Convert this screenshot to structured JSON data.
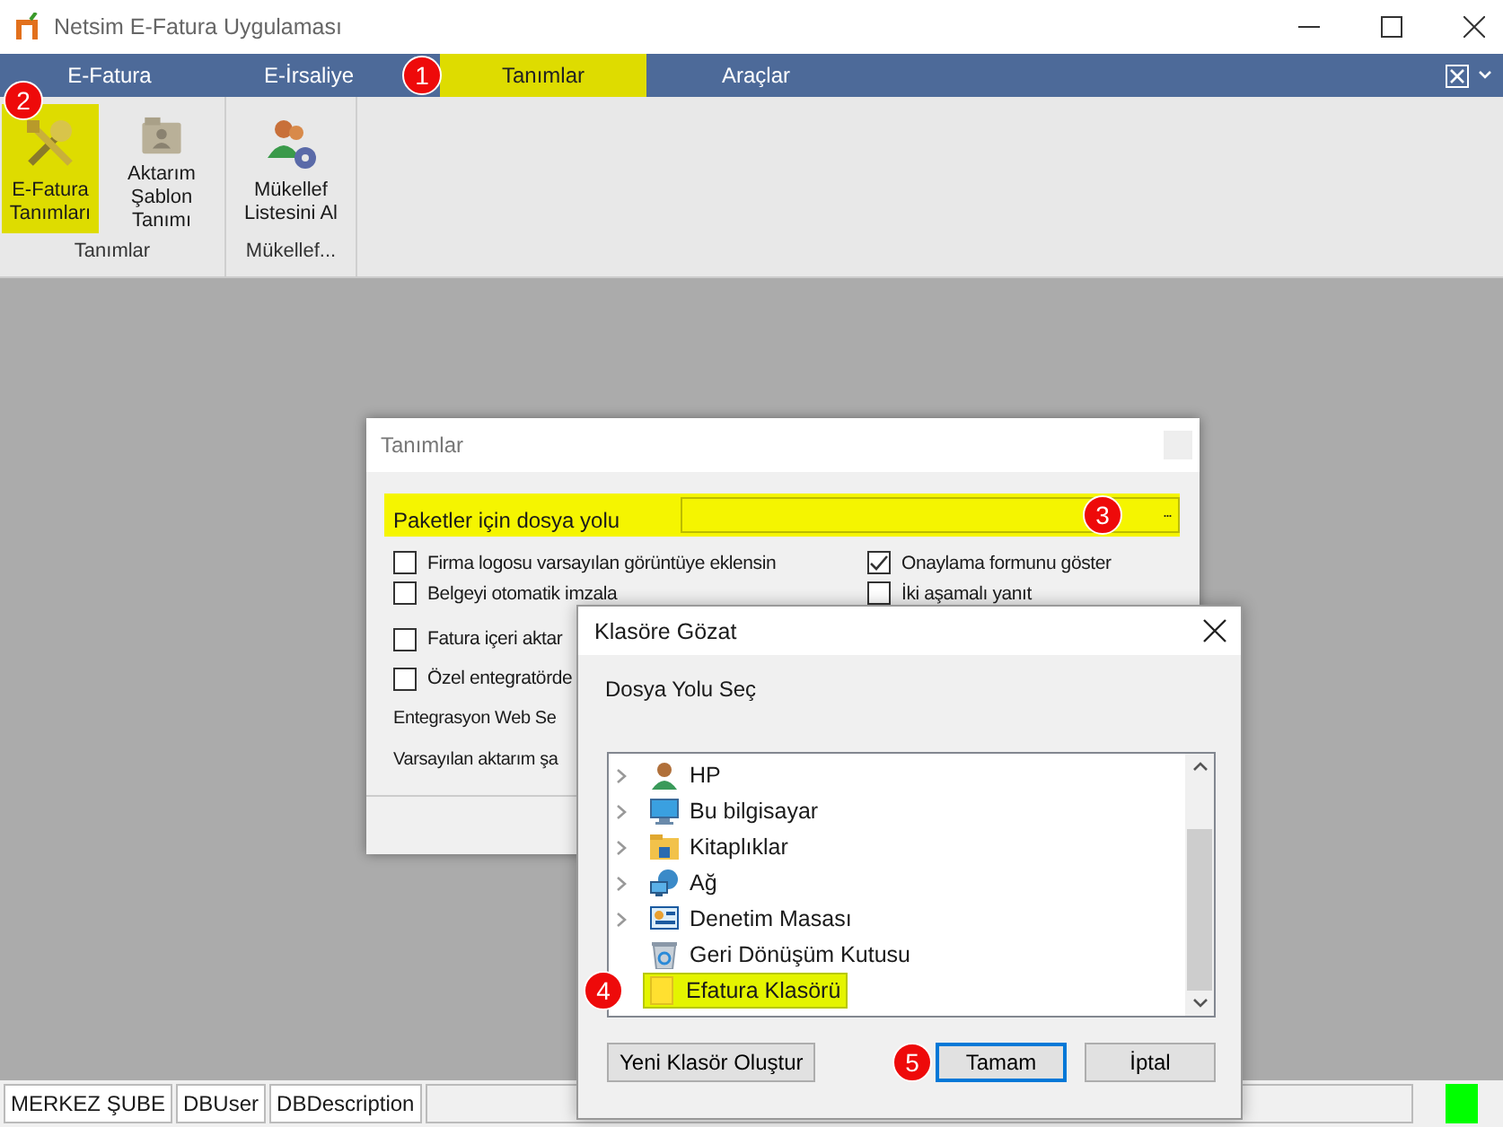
{
  "window": {
    "title": "Netsim E-Fatura Uygulaması"
  },
  "tabs": [
    {
      "label": "E-Fatura",
      "selected": false
    },
    {
      "label": "E-İrsaliye",
      "selected": false
    },
    {
      "label": "Tanımlar",
      "selected": true
    },
    {
      "label": "Araçlar",
      "selected": false
    }
  ],
  "ribbon": {
    "groups": [
      {
        "label": "Tanımlar",
        "buttons": [
          {
            "kind": "tools",
            "label": "E-Fatura Tanımları",
            "selected": true
          },
          {
            "kind": "folder",
            "label": "Aktarım Şablon Tanımı",
            "selected": false
          }
        ]
      },
      {
        "label": "Mükellef...",
        "buttons": [
          {
            "kind": "users",
            "label": "Mükellef Listesini Al",
            "selected": false
          }
        ]
      }
    ]
  },
  "settings_dialog": {
    "title": "Tanımlar",
    "path_label": "Paketler için dosya yolu",
    "browse": "...",
    "options_left": [
      {
        "label": "Firma logosu varsayılan görüntüye eklensin",
        "checked": false
      },
      {
        "label": "Belgeyi otomatik imzala",
        "checked": false
      },
      {
        "label": "Fatura içeri aktar",
        "checked": false
      },
      {
        "label": "Özel entegratörde",
        "checked": false
      }
    ],
    "options_right": [
      {
        "label": "Onaylama formunu göster",
        "checked": true
      },
      {
        "label": "İki aşamalı yanıt",
        "checked": false
      }
    ],
    "fields": [
      "Entegrasyon Web Se",
      "Varsayılan aktarım şa"
    ]
  },
  "browse_dialog": {
    "title": "Klasöre Gözat",
    "prompt": "Dosya Yolu Seç",
    "tree": [
      {
        "kind": "user",
        "label": "HP",
        "expandable": true,
        "selected": false
      },
      {
        "kind": "computer",
        "label": "Bu bilgisayar",
        "expandable": true,
        "selected": false
      },
      {
        "kind": "libraries",
        "label": "Kitaplıklar",
        "expandable": true,
        "selected": false
      },
      {
        "kind": "network",
        "label": "Ağ",
        "expandable": true,
        "selected": false
      },
      {
        "kind": "control-panel",
        "label": "Denetim Masası",
        "expandable": true,
        "selected": false
      },
      {
        "kind": "recycle-bin",
        "label": "Geri Dönüşüm Kutusu",
        "expandable": false,
        "selected": false
      },
      {
        "kind": "folder",
        "label": "Efatura Klasörü",
        "expandable": false,
        "selected": true
      }
    ],
    "buttons": [
      {
        "label": "Yeni Klasör Oluştur",
        "focused": false
      },
      {
        "label": "Tamam",
        "focused": true
      },
      {
        "label": "İptal",
        "focused": false
      }
    ]
  },
  "status_bar": [
    "MERKEZ ŞUBE",
    "DBUser",
    "DBDescription"
  ],
  "annotations": [
    "1",
    "2",
    "3",
    "4",
    "5"
  ]
}
